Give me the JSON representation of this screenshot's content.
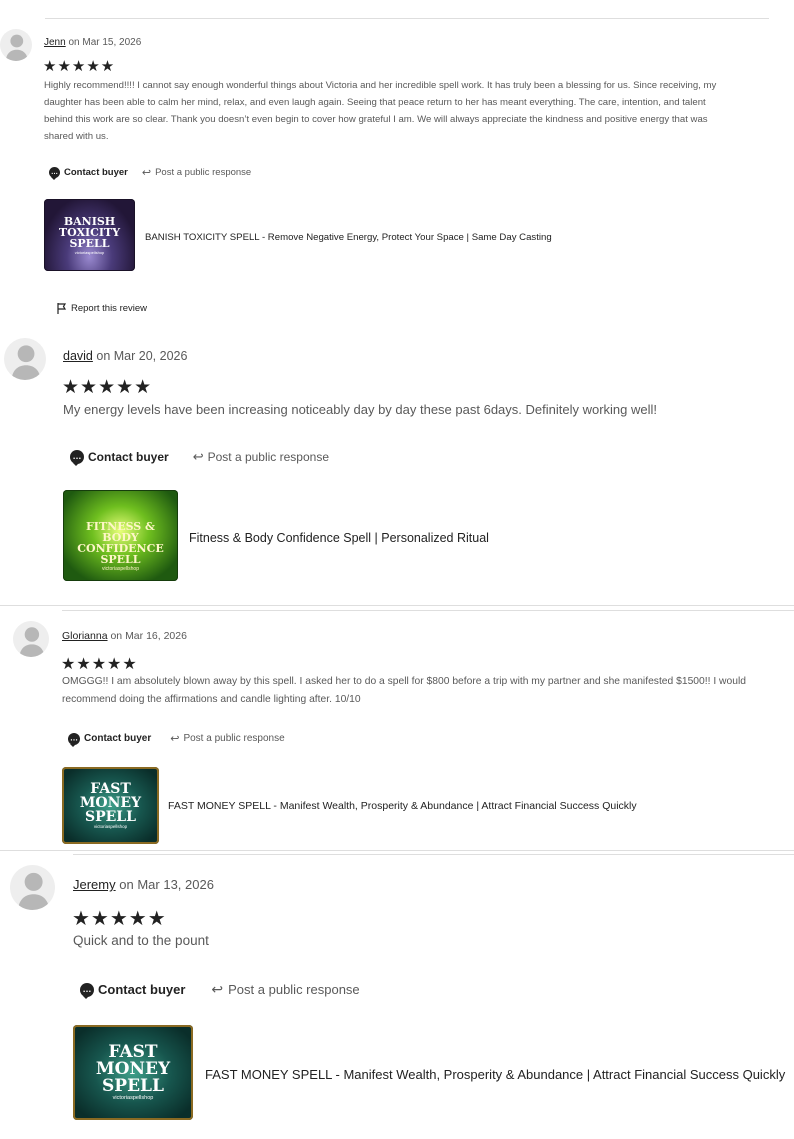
{
  "reviews": [
    {
      "reviewer": "Jenn",
      "date_prefix": "on",
      "date": "Mar 15, 2026",
      "stars": "★★★★★",
      "text": "Highly recommend!!!! I cannot say enough wonderful things about Victoria and her incredible spell work. It has truly been a blessing for us. Since receiving, my daughter has been able to calm her mind, relax, and even laugh again. Seeing that peace return to her has meant everything. The care, intention, and talent behind this work are so clear. Thank you doesn’t even begin to cover how grateful I am. We will always appreciate the kindness and positive energy that was shared with us.",
      "contact_label": "Contact buyer",
      "public_label": "Post a public response",
      "product": {
        "thumb_lines": [
          "BANISH",
          "TOXICITY",
          "SPELL"
        ],
        "thumb_sub": "victoriaspellshop",
        "title": "BANISH TOXICITY SPELL - Remove Negative Energy, Protect Your Space | Same Day Casting"
      },
      "report_label": "Report this review"
    },
    {
      "reviewer": "david",
      "date_prefix": "on",
      "date": "Mar 20, 2026",
      "stars": "★★★★★",
      "text": "My energy levels have been increasing noticeably day by day these past 6days. Definitely working well!",
      "contact_label": "Contact buyer",
      "public_label": "Post a public response",
      "product": {
        "thumb_lines": [
          "FITNESS &",
          "BODY CONFIDENCE",
          "SPELL"
        ],
        "thumb_sub": "victoriaspellshop",
        "title": "Fitness & Body Confidence Spell | Personalized Ritual"
      }
    },
    {
      "reviewer": "Glorianna",
      "date_prefix": "on",
      "date": "Mar 16, 2026",
      "stars": "★★★★★",
      "text": "OMGGG!! I am absolutely blown away by this spell. I asked her to do a spell for $800 before a trip with my partner and she manifested $1500!! I would recommend doing the affirmations and candle lighting after. 10/10",
      "contact_label": "Contact buyer",
      "public_label": "Post a public response",
      "product": {
        "thumb_lines": [
          "FAST",
          "MONEY",
          "SPELL"
        ],
        "thumb_sub": "victoriaspellshop",
        "title": "FAST MONEY SPELL - Manifest Wealth, Prosperity & Abundance | Attract Financial Success Quickly"
      }
    },
    {
      "reviewer": "Jeremy",
      "date_prefix": "on",
      "date": "Mar 13, 2026",
      "stars": "★★★★★",
      "text": "Quick and to the pount",
      "contact_label": "Contact buyer",
      "public_label": "Post a public response",
      "product": {
        "thumb_lines": [
          "FAST",
          "MONEY",
          "SPELL"
        ],
        "thumb_sub": "victoriaspellshop",
        "title": "FAST MONEY SPELL - Manifest Wealth, Prosperity & Abundance | Attract Financial Success Quickly"
      }
    }
  ],
  "icons": {
    "avatar": "person-silhouette-icon",
    "contact": "speech-bubble-icon",
    "public": "reply-arrow-icon",
    "report": "flag-icon",
    "star": "star-icon"
  },
  "colors": {
    "text_primary": "#222222",
    "text_secondary": "#595959",
    "divider": "#dedede",
    "banish_bg": "#3b2a5c",
    "fitness_bg": "#2f7a1c",
    "money_bg": "#0f4a45"
  }
}
